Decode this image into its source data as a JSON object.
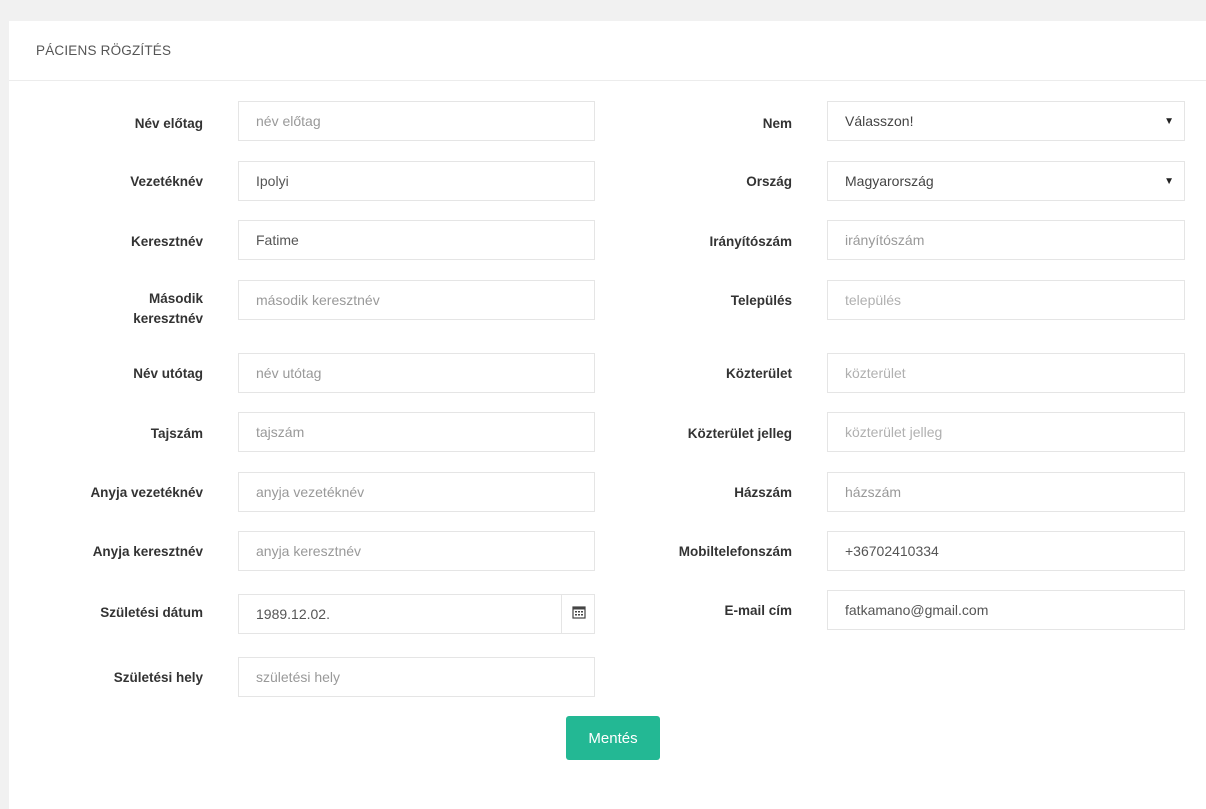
{
  "panel": {
    "title": "PÁCIENS RÖGZÍTÉS"
  },
  "left_fields": [
    {
      "label": "Név előtag",
      "value": "",
      "placeholder": "név előtag"
    },
    {
      "label": "Vezetéknév",
      "value": "Ipolyi",
      "placeholder": ""
    },
    {
      "label": "Keresztnév",
      "value": "Fatime",
      "placeholder": ""
    },
    {
      "label_line1": "Második",
      "label_line2": "keresztnév",
      "value": "",
      "placeholder": "második keresztnév"
    },
    {
      "label": "Név utótag",
      "value": "",
      "placeholder": "név utótag"
    },
    {
      "label": "Tajszám",
      "value": "",
      "placeholder": "tajszám"
    },
    {
      "label": "Anyja vezetéknév",
      "value": "",
      "placeholder": "anyja vezetéknév"
    },
    {
      "label": "Anyja keresztnév",
      "value": "",
      "placeholder": "anyja keresztnév"
    },
    {
      "label": "Születési dátum",
      "value": "1989.12.02.",
      "placeholder": ""
    },
    {
      "label": "Születési hely",
      "value": "",
      "placeholder": "születési hely"
    }
  ],
  "right_fields": [
    {
      "label": "Nem",
      "selected": "Válasszon!"
    },
    {
      "label": "Ország",
      "selected": "Magyarország"
    },
    {
      "label": "Irányítószám",
      "value": "",
      "placeholder": "irányítószám"
    },
    {
      "label": "Település",
      "value": "",
      "placeholder": "település"
    },
    {
      "label": "Közterület",
      "value": "",
      "placeholder": "közterület"
    },
    {
      "label": "Közterület jelleg",
      "value": "",
      "placeholder": "közterület jelleg"
    },
    {
      "label": "Házszám",
      "value": "",
      "placeholder": "házszám"
    },
    {
      "label": "Mobiltelefonszám",
      "value": "+36702410334",
      "placeholder": ""
    },
    {
      "label": "E-mail cím",
      "value": "fatkamano@gmail.com",
      "placeholder": ""
    }
  ],
  "actions": {
    "save_label": "Mentés"
  },
  "icons": {
    "select_caret": "caret-down-icon",
    "date_picker": "calendar-icon"
  },
  "colors": {
    "accent": "#23b894",
    "border": "#e5e5e5",
    "background": "#f1f1f1"
  }
}
